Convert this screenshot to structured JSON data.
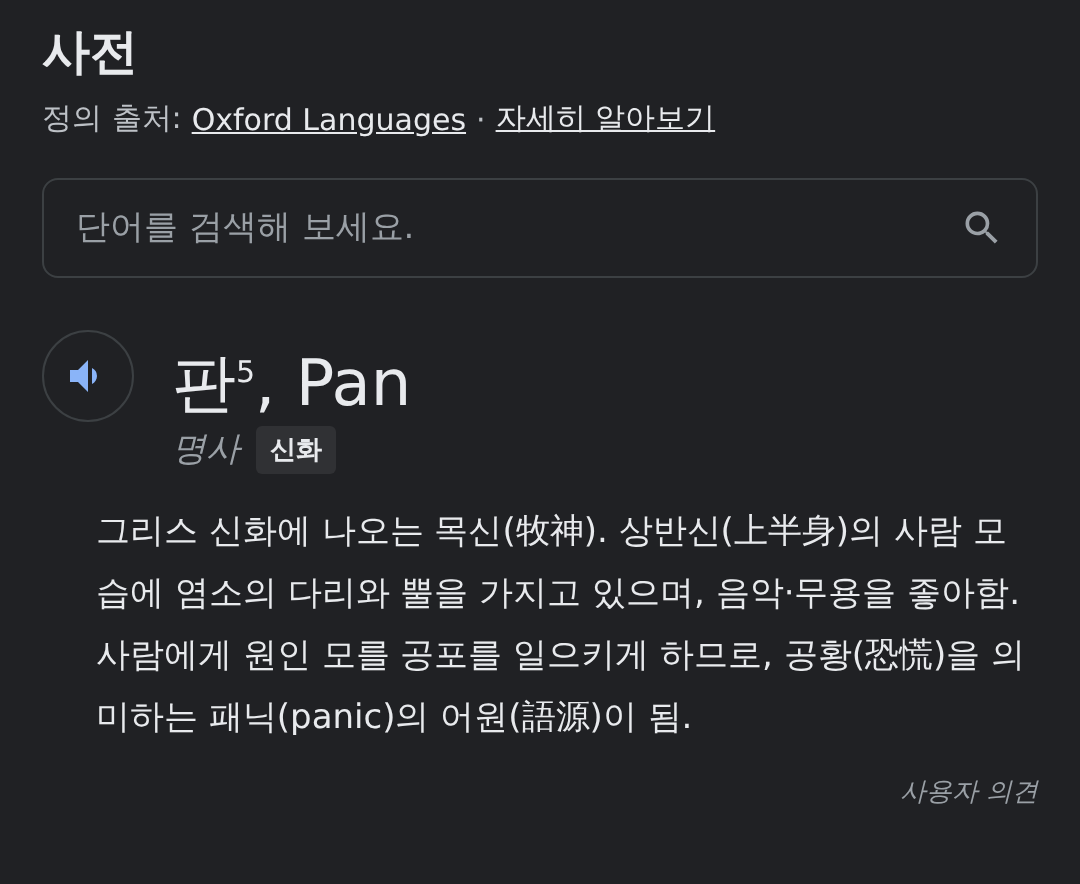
{
  "title": "사전",
  "source": {
    "prefix": "정의 출처:",
    "link": "Oxford Languages",
    "separator": "·",
    "learn_more": "자세히 알아보기"
  },
  "search": {
    "placeholder": "단어를 검색해 보세요."
  },
  "entry": {
    "headword": "판$^{5}$, Pan",
    "part_of_speech": "명사",
    "tag": "신화",
    "definition": "그리스 신화에 나오는 목신(牧神). 상반신(上半身)의 사람 모습에 염소의 다리와 뿔을 가지고 있으며, 음악·무용을 좋아함. 사람에게 원인 모를 공포를 일으키게 하므로, 공황(恐慌)을 의미하는 패닉(panic)의 어원(語源)이 됨."
  },
  "feedback": "사용자 의견"
}
